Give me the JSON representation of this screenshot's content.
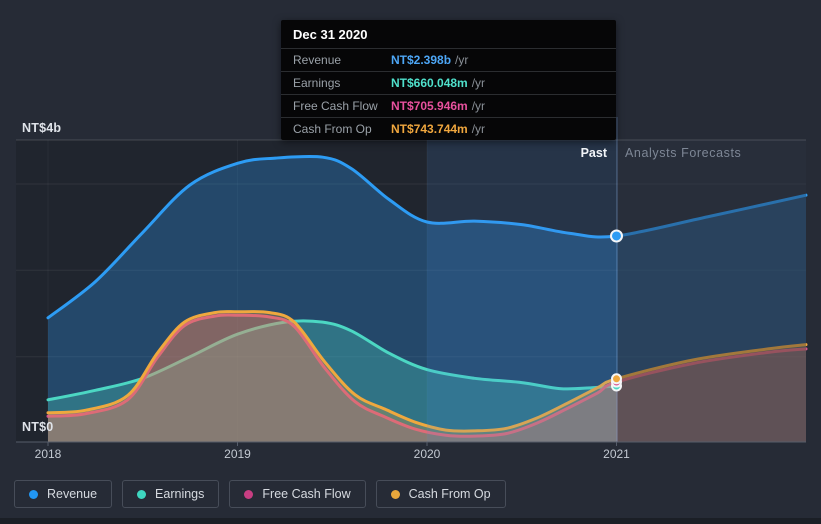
{
  "chart": {
    "y_axis": {
      "max_label": "NT$4b",
      "min_label": "NT$0"
    },
    "x_tick_labels": [
      "2018",
      "2019",
      "2020",
      "2021"
    ],
    "past_label": "Past",
    "forecast_label": "Analysts Forecasts"
  },
  "tooltip": {
    "title": "Dec 31 2020",
    "rows": [
      {
        "label": "Revenue",
        "value": "NT$2.398b",
        "unit": "/yr",
        "color": "#4da6f5"
      },
      {
        "label": "Earnings",
        "value": "NT$660.048m",
        "unit": "/yr",
        "color": "#4fe0cb"
      },
      {
        "label": "Free Cash Flow",
        "value": "NT$705.946m",
        "unit": "/yr",
        "color": "#e8519e"
      },
      {
        "label": "Cash From Op",
        "value": "NT$743.744m",
        "unit": "/yr",
        "color": "#f0a73e"
      }
    ]
  },
  "legend": {
    "items": [
      {
        "label": "Revenue",
        "color": "#2196f3"
      },
      {
        "label": "Earnings",
        "color": "#3ed6c0"
      },
      {
        "label": "Free Cash Flow",
        "color": "#c73e82"
      },
      {
        "label": "Cash From Op",
        "color": "#e8a73c"
      }
    ]
  },
  "chart_data": {
    "type": "area",
    "title": "Past and forecast Revenue, Earnings and Cash Flow (NT$ billions per year)",
    "x_unit": "year",
    "xlim": [
      2017.83,
      2022.0
    ],
    "ylim": [
      0,
      4
    ],
    "x_tick_years": [
      2018,
      2019,
      2020,
      2021
    ],
    "y_gridline_values": [
      1,
      2,
      3
    ],
    "past_until": 2021,
    "highlight_band_years": [
      2020,
      2021
    ],
    "marker_date": "Dec 31 2020",
    "marker_values_billions": {
      "revenue": 2.398,
      "earnings": 0.660048,
      "free_cash_flow": 0.705946,
      "cash_from_op": 0.743744
    },
    "series": [
      {
        "name": "Revenue",
        "color": "#2d9cf4",
        "fill_opacity": 0.3,
        "has_forecast": true,
        "past": [
          [
            2018.0,
            1.45
          ],
          [
            2018.25,
            1.87
          ],
          [
            2018.5,
            2.44
          ],
          [
            2018.75,
            2.99
          ],
          [
            2019.0,
            3.24
          ],
          [
            2019.2,
            3.3
          ],
          [
            2019.45,
            3.31
          ],
          [
            2019.6,
            3.18
          ],
          [
            2019.8,
            2.82
          ],
          [
            2020.0,
            2.56
          ],
          [
            2020.25,
            2.57
          ],
          [
            2020.5,
            2.53
          ],
          [
            2020.75,
            2.43
          ],
          [
            2021.0,
            2.398
          ]
        ],
        "forecast": [
          [
            2021.0,
            2.398
          ],
          [
            2021.5,
            2.63
          ],
          [
            2022.0,
            2.87
          ]
        ]
      },
      {
        "name": "Earnings",
        "color": "#4cd7c3",
        "fill_opacity": 0.3,
        "has_forecast": false,
        "past": [
          [
            2018.0,
            0.5
          ],
          [
            2018.25,
            0.61
          ],
          [
            2018.5,
            0.75
          ],
          [
            2018.75,
            1.0
          ],
          [
            2019.0,
            1.26
          ],
          [
            2019.25,
            1.4
          ],
          [
            2019.45,
            1.4
          ],
          [
            2019.6,
            1.3
          ],
          [
            2019.8,
            1.04
          ],
          [
            2020.0,
            0.85
          ],
          [
            2020.25,
            0.75
          ],
          [
            2020.5,
            0.7
          ],
          [
            2020.7,
            0.63
          ],
          [
            2020.87,
            0.64
          ],
          [
            2021.0,
            0.660048
          ]
        ],
        "forecast": []
      },
      {
        "name": "Free Cash Flow",
        "color": "#d6548e",
        "fill_opacity": 0.28,
        "has_forecast": true,
        "past": [
          [
            2018.0,
            0.31
          ],
          [
            2018.2,
            0.34
          ],
          [
            2018.42,
            0.5
          ],
          [
            2018.58,
            1.0
          ],
          [
            2018.72,
            1.36
          ],
          [
            2018.88,
            1.47
          ],
          [
            2019.0,
            1.48
          ],
          [
            2019.17,
            1.46
          ],
          [
            2019.3,
            1.35
          ],
          [
            2019.46,
            0.87
          ],
          [
            2019.62,
            0.48
          ],
          [
            2019.78,
            0.3
          ],
          [
            2019.94,
            0.16
          ],
          [
            2020.1,
            0.09
          ],
          [
            2020.25,
            0.08
          ],
          [
            2020.42,
            0.11
          ],
          [
            2020.58,
            0.23
          ],
          [
            2020.74,
            0.4
          ],
          [
            2020.9,
            0.58
          ],
          [
            2021.0,
            0.705946
          ]
        ],
        "forecast": [
          [
            2021.0,
            0.705946
          ],
          [
            2021.4,
            0.92
          ],
          [
            2021.8,
            1.05
          ],
          [
            2022.0,
            1.09
          ]
        ]
      },
      {
        "name": "Cash From Op",
        "color": "#efa83e",
        "fill_opacity": 0.28,
        "has_forecast": true,
        "past": [
          [
            2018.0,
            0.35
          ],
          [
            2018.2,
            0.38
          ],
          [
            2018.42,
            0.55
          ],
          [
            2018.58,
            1.05
          ],
          [
            2018.72,
            1.4
          ],
          [
            2018.88,
            1.51
          ],
          [
            2019.0,
            1.52
          ],
          [
            2019.17,
            1.51
          ],
          [
            2019.3,
            1.4
          ],
          [
            2019.46,
            0.94
          ],
          [
            2019.62,
            0.56
          ],
          [
            2019.78,
            0.39
          ],
          [
            2019.94,
            0.24
          ],
          [
            2020.1,
            0.15
          ],
          [
            2020.25,
            0.14
          ],
          [
            2020.42,
            0.17
          ],
          [
            2020.58,
            0.29
          ],
          [
            2020.74,
            0.46
          ],
          [
            2020.9,
            0.64
          ],
          [
            2021.0,
            0.743744
          ]
        ],
        "forecast": [
          [
            2021.0,
            0.743744
          ],
          [
            2021.4,
            0.96
          ],
          [
            2021.8,
            1.09
          ],
          [
            2022.0,
            1.14
          ]
        ]
      }
    ],
    "legend_position": "bottom-left",
    "grid": true
  }
}
